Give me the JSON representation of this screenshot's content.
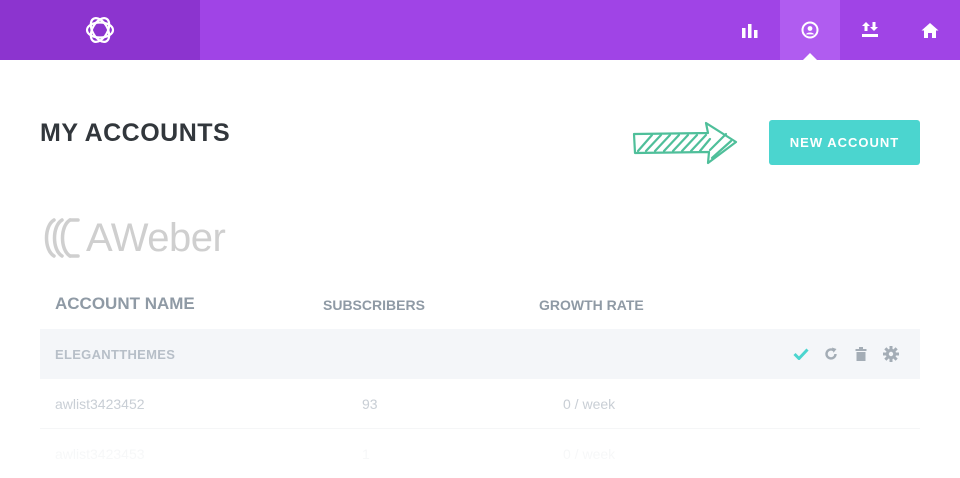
{
  "colors": {
    "topbar": "#a044e6",
    "logo_bg": "#8c34cf",
    "active_nav": "#b05cf0",
    "accent": "#4bd5cf",
    "title": "#32373c",
    "header_text": "#8f9aa5",
    "check": "#4bd5cf"
  },
  "topbar": {
    "logo_icon": "bloom-flower-logo",
    "nav": [
      {
        "icon": "bar-chart-icon",
        "active": false
      },
      {
        "icon": "user-circle-icon",
        "active": true
      },
      {
        "icon": "import-export-icon",
        "active": false
      },
      {
        "icon": "home-icon",
        "active": false
      }
    ]
  },
  "header": {
    "title": "MY ACCOUNTS",
    "new_account_label": "NEW ACCOUNT"
  },
  "provider": {
    "name": "AWeber"
  },
  "table": {
    "columns": [
      "ACCOUNT NAME",
      "SUBSCRIBERS",
      "GROWTH RATE"
    ],
    "group": {
      "name": "ELEGANTTHEMES",
      "actions": [
        "check-icon",
        "refresh-icon",
        "trash-icon",
        "gear-icon"
      ]
    },
    "rows": [
      {
        "name": "awlist3423452",
        "subscribers": "93",
        "growth": "0 / week"
      },
      {
        "name": "awlist3423453",
        "subscribers": "1",
        "growth": "0 / week"
      }
    ]
  }
}
